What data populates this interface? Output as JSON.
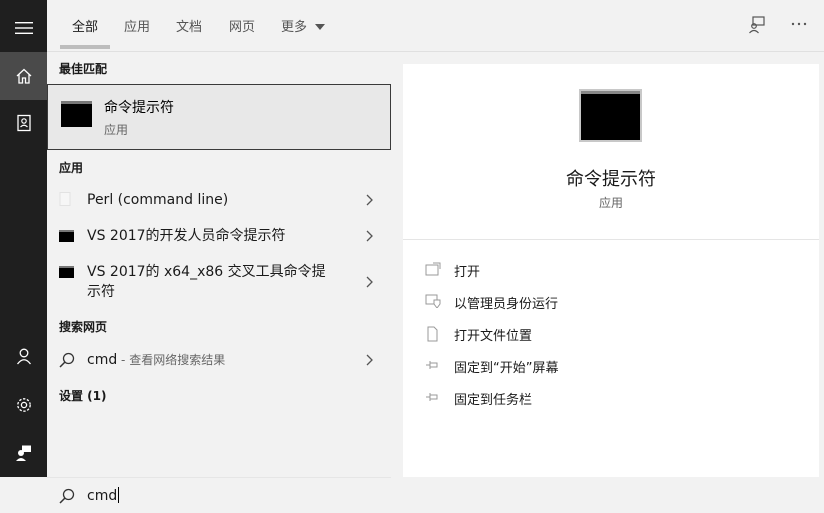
{
  "tabs": [
    {
      "label": "全部"
    },
    {
      "label": "应用"
    },
    {
      "label": "文档"
    },
    {
      "label": "网页"
    },
    {
      "label": "更多"
    }
  ],
  "sections": {
    "best_match": "最佳匹配",
    "apps": "应用",
    "web": "搜索网页",
    "settings": "设置 (1)"
  },
  "best_match": {
    "name": "命令提示符",
    "kind": "应用"
  },
  "apps": [
    {
      "label": "Perl (command line)"
    },
    {
      "label": "VS 2017的开发人员命令提示符"
    },
    {
      "label_line1": "VS 2017的 x64_x86 交叉工具命令提",
      "label_line2": "示符"
    }
  ],
  "web": {
    "query": "cmd",
    "hint": " - 查看网络搜索结果"
  },
  "search": {
    "value": "cmd"
  },
  "preview": {
    "name": "命令提示符",
    "kind": "应用",
    "actions": [
      {
        "label": "打开",
        "icon": "open-icon"
      },
      {
        "label": "以管理员身份运行",
        "icon": "shield-run-icon"
      },
      {
        "label": "打开文件位置",
        "icon": "file-location-icon"
      },
      {
        "label": "固定到“开始”屏幕",
        "icon": "pin-icon"
      },
      {
        "label": "固定到任务栏",
        "icon": "pin-icon"
      }
    ]
  },
  "colors": {
    "rail": "#1f1f1f",
    "rail_active": "#4a4a4a",
    "panel": "#f2f2f2",
    "preview": "#ffffff"
  }
}
